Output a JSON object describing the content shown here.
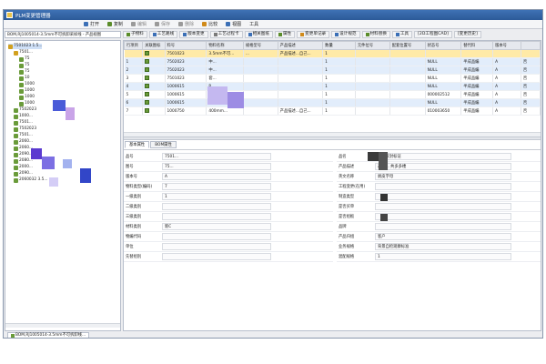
{
  "window": {
    "title": "PLM变更管理器"
  },
  "menu": [
    {
      "label": "打开",
      "icon": "open-icon",
      "color": "#3b6fb6"
    },
    {
      "label": "复制",
      "icon": "copy-icon",
      "color": "#5a8c2a"
    },
    {
      "label": "编辑",
      "icon": "edit-icon",
      "color": "#7a7a7a"
    },
    {
      "label": "保存",
      "icon": "save-icon",
      "color": "#7a7a7a"
    },
    {
      "label": "删除",
      "icon": "delete-icon",
      "color": "#7a7a7a"
    },
    {
      "label": "比较",
      "icon": "compare-icon",
      "color": "#d08a1a"
    },
    {
      "label": "视图",
      "icon": "view-icon",
      "color": "#3b6fb6"
    },
    {
      "label": "工具",
      "icon": "tools-icon",
      "color": "#3b6fb6"
    }
  ],
  "path": "BOM,RJ1005014-3.5mm不可拆卸采样线 - 产品视图",
  "tabs": [
    {
      "label": "子物料",
      "icon": "item-icon"
    },
    {
      "label": "工艺路线",
      "icon": "route-icon"
    },
    {
      "label": "版本变更",
      "icon": "version-icon"
    },
    {
      "label": "工艺过程卡",
      "icon": "card-icon"
    },
    {
      "label": "相关图纸",
      "icon": "drawing-icon"
    },
    {
      "label": "属性",
      "icon": "attr-icon"
    },
    {
      "label": "变更单记录",
      "icon": "change-icon"
    },
    {
      "label": "设计规范",
      "icon": "spec-icon"
    },
    {
      "label": "材料替换",
      "icon": "material-icon"
    },
    {
      "label": "工具",
      "icon": "tool-icon"
    },
    {
      "label": "[2D工程图CAD]",
      "icon": ""
    },
    {
      "label": "[变更历史]",
      "icon": ""
    }
  ],
  "tree": [
    {
      "label": "7501023 1.5...",
      "level": 0,
      "selected": true
    },
    {
      "label": "7501...",
      "level": 1,
      "selected": false
    },
    {
      "label": "75",
      "level": 2,
      "selected": false
    },
    {
      "label": "75",
      "level": 2,
      "selected": false
    },
    {
      "label": "75",
      "level": 2,
      "selected": false
    },
    {
      "label": "10",
      "level": 2,
      "selected": false
    },
    {
      "label": "1000",
      "level": 2,
      "selected": false
    },
    {
      "label": "1000",
      "level": 2,
      "selected": false
    },
    {
      "label": "1000",
      "level": 2,
      "selected": false
    },
    {
      "label": "1000",
      "level": 2,
      "selected": false
    },
    {
      "label": "7502023",
      "level": 1,
      "selected": false
    },
    {
      "label": "1000...",
      "level": 1,
      "selected": false
    },
    {
      "label": "7501...",
      "level": 1,
      "selected": false
    },
    {
      "label": "7502023",
      "level": 1,
      "selected": false
    },
    {
      "label": "7501...",
      "level": 1,
      "selected": false
    },
    {
      "label": "2060...",
      "level": 1,
      "selected": false
    },
    {
      "label": "2060...",
      "level": 1,
      "selected": false
    },
    {
      "label": "2090...",
      "level": 1,
      "selected": false
    },
    {
      "label": "2080...",
      "level": 1,
      "selected": false
    },
    {
      "label": "2000...",
      "level": 1,
      "selected": false
    },
    {
      "label": "2090...",
      "level": 1,
      "selected": false
    },
    {
      "label": "2060032 3.5...",
      "level": 1,
      "selected": false
    }
  ],
  "grid": {
    "columns": [
      "行项目",
      "关联图标",
      "料号",
      "物料名称",
      "规格型号",
      "产品描述",
      "数量",
      "元件位号",
      "配套位置号",
      "状态号",
      "替代料",
      "版本号"
    ],
    "rows": [
      {
        "no": "",
        "code": "7501023",
        "name": "3.5mm不可...",
        "desc": "...",
        "pdesc": "产品描述...自己...",
        "qty": "1",
        "loc": "",
        "pos": "",
        "status": "",
        "alt": "",
        "ver": "",
        "sel": true
      },
      {
        "no": "1",
        "code": "7502023",
        "name": "中...",
        "desc": "",
        "pdesc": "",
        "qty": "1",
        "loc": "",
        "pos": "",
        "status": "NULL",
        "alt": "半成品编",
        "ver": "A",
        "sel": false
      },
      {
        "no": "2",
        "code": "7502023",
        "name": "中...",
        "desc": "",
        "pdesc": "",
        "qty": "1",
        "loc": "",
        "pos": "",
        "status": "NULL",
        "alt": "半成品编",
        "ver": "A",
        "sel": false
      },
      {
        "no": "3",
        "code": "7501023",
        "name": "套...",
        "desc": "",
        "pdesc": "",
        "qty": "1",
        "loc": "",
        "pos": "",
        "status": "NULL",
        "alt": "半成品编",
        "ver": "A",
        "sel": false
      },
      {
        "no": "4",
        "code": "1000615",
        "name": "P...",
        "desc": "",
        "pdesc": "",
        "qty": "1",
        "loc": "",
        "pos": "",
        "status": "NULL",
        "alt": "半成品编",
        "ver": "A",
        "sel": false
      },
      {
        "no": "5",
        "code": "1000615",
        "name": "...",
        "desc": "",
        "pdesc": "",
        "qty": "1",
        "loc": "",
        "pos": "",
        "status": "000002512",
        "alt": "半成品编",
        "ver": "A",
        "sel": false
      },
      {
        "no": "6",
        "code": "1000615",
        "name": "...",
        "desc": "",
        "pdesc": "",
        "qty": "1",
        "loc": "",
        "pos": "",
        "status": "NULL",
        "alt": "半成品编",
        "ver": "A",
        "sel": false
      },
      {
        "no": "7",
        "code": "1000750",
        "name": "400mm...",
        "desc": "",
        "pdesc": "产品描述...自己...",
        "qty": "1",
        "loc": "",
        "pos": "",
        "status": "010003650",
        "alt": "半成品编",
        "ver": "A",
        "sel": false
      }
    ],
    "right_col": [
      "",
      "否",
      "否",
      "否",
      "否",
      "否",
      "否",
      "否"
    ]
  },
  "prop_tabs": [
    "基本属性",
    "BOM属性"
  ],
  "props_left": [
    {
      "label": "品号",
      "value": "7501..."
    },
    {
      "label": "图号",
      "value": "75..."
    },
    {
      "label": "版本号",
      "value": "A"
    },
    {
      "label": "物料类型(编码)",
      "value": "7"
    },
    {
      "label": "一级类别",
      "value": "1"
    },
    {
      "label": "二级类别",
      "value": ""
    },
    {
      "label": "三级类别",
      "value": ""
    },
    {
      "label": "材料类别",
      "value": "新C"
    },
    {
      "label": "物编代码",
      "value": ""
    },
    {
      "label": "单位",
      "value": ""
    },
    {
      "label": "先替组别",
      "value": ""
    }
  ],
  "props_right": [
    {
      "label": "品名",
      "value": "自置拆封标证"
    },
    {
      "label": "产品描述",
      "value": "产品... 共多多楼"
    },
    {
      "label": "英文名称",
      "value": "剥皮字母"
    },
    {
      "label": "工程变更(在用)",
      "value": ""
    },
    {
      "label": "制造类型",
      "value": ""
    },
    {
      "label": "是否买单",
      "value": ""
    },
    {
      "label": "是否组板",
      "value": ""
    },
    {
      "label": "品牌",
      "value": ""
    },
    {
      "label": "产品归组",
      "value": "客户"
    },
    {
      "label": "业务规格",
      "value": "背景自检观察标准"
    },
    {
      "label": "混配规格",
      "value": "1"
    }
  ],
  "status_tab": "BOM,RJ1005014-3.5mm不可拆卸线..."
}
